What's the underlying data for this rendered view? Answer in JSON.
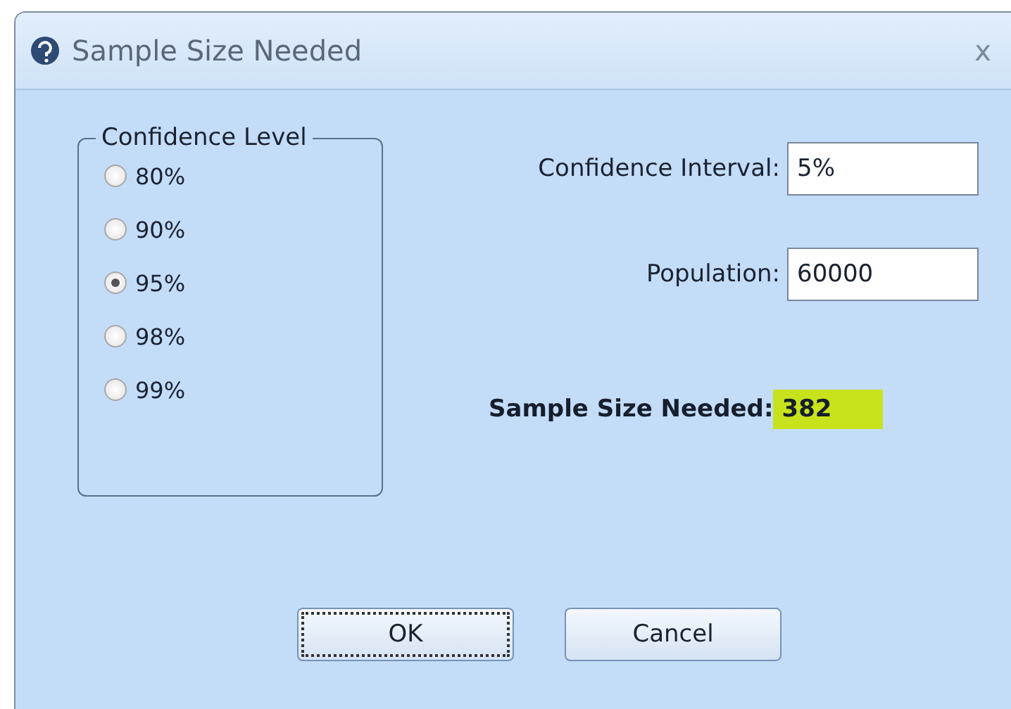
{
  "window": {
    "title": "Sample Size Needed",
    "close": "x"
  },
  "confidence_level": {
    "label": "Confidence Level",
    "options": [
      {
        "label": "80%",
        "selected": false
      },
      {
        "label": "90%",
        "selected": false
      },
      {
        "label": "95%",
        "selected": true
      },
      {
        "label": "98%",
        "selected": false
      },
      {
        "label": "99%",
        "selected": false
      }
    ]
  },
  "fields": [
    {
      "label": "Confidence Interval:",
      "value": "5%"
    },
    {
      "label": "Population:",
      "value": "60000"
    }
  ],
  "result": {
    "label": "Sample Size Needed:",
    "value": "382"
  },
  "buttons": [
    {
      "label": "OK",
      "focused": true
    },
    {
      "label": "Cancel",
      "focused": false
    }
  ]
}
